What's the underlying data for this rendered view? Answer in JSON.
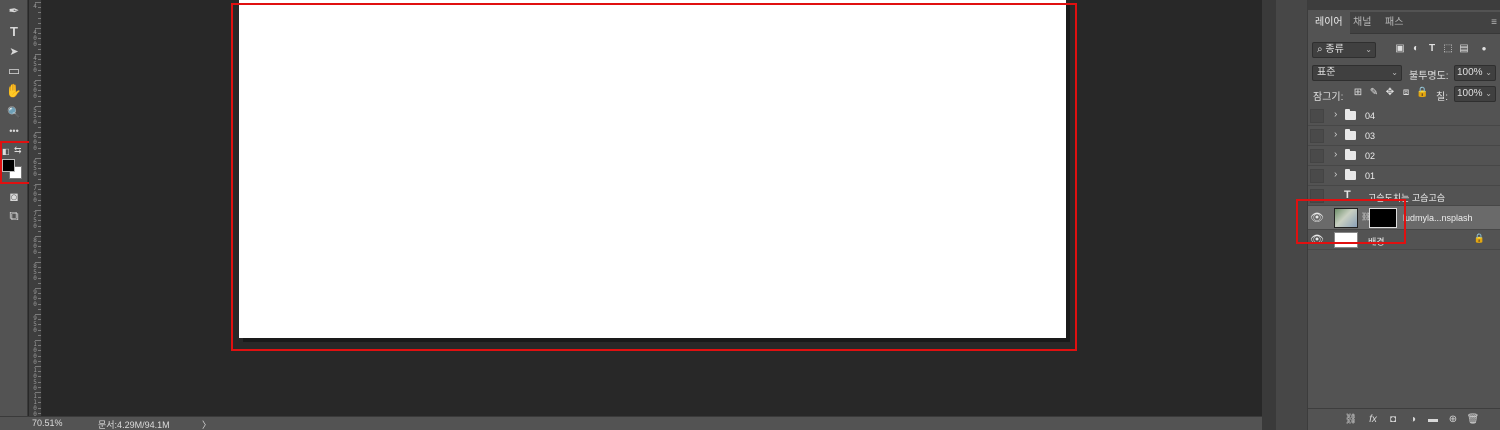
{
  "toolbar": {
    "tools": [
      {
        "name": "pen-tool-icon",
        "glyph": "✒"
      },
      {
        "name": "type-tool-icon",
        "glyph": "T"
      },
      {
        "name": "path-selection-tool-icon",
        "glyph": "➤"
      },
      {
        "name": "rectangle-tool-icon",
        "glyph": "▭"
      },
      {
        "name": "hand-tool-icon",
        "glyph": "✋"
      },
      {
        "name": "zoom-tool-icon",
        "glyph": "🔍"
      },
      {
        "name": "more-tools-icon",
        "glyph": "•••"
      },
      {
        "name": "quick-mask-icon",
        "glyph": "◙"
      },
      {
        "name": "screen-mode-icon",
        "glyph": "⧉"
      }
    ],
    "foreground_color": "#000000",
    "background_color": "#ffffff"
  },
  "ruler": {
    "labels": [
      "4",
      "4 0 0",
      "4 5 0",
      "5 0 0",
      "5 5 0",
      "6 0 0",
      "6 5 0",
      "7 0 0",
      "7 5 0",
      "8 0 0",
      "8 5 0",
      "9 0 0",
      "9 5 0",
      "1 0 0 0",
      "1 0 5 0",
      "1 1 0 0"
    ]
  },
  "status": {
    "zoom": "70.51%",
    "doc_info": "문서:4.29M/94.1M",
    "arrow": "〉"
  },
  "layers_panel": {
    "tabs": [
      {
        "label": "레이어",
        "active": true
      },
      {
        "label": "채널",
        "active": false
      },
      {
        "label": "패스",
        "active": false
      }
    ],
    "menu": "≡",
    "filter_kind": "종류",
    "blend_mode": "표준",
    "opacity_label": "불투명도:",
    "opacity_value": "100%",
    "lock_label": "잠그기:",
    "fill_label": "칠:",
    "fill_value": "100%",
    "layers": [
      {
        "kind": "group",
        "name": "04",
        "visible": false
      },
      {
        "kind": "group",
        "name": "03",
        "visible": false
      },
      {
        "kind": "group",
        "name": "02",
        "visible": false
      },
      {
        "kind": "group",
        "name": "01",
        "visible": false
      },
      {
        "kind": "text",
        "name": "고슴도치는 고슴고슴",
        "visible": false
      },
      {
        "kind": "masked-image",
        "name": "ludmyla...nsplash",
        "visible": true,
        "selected": true
      },
      {
        "kind": "background",
        "name": "배경",
        "visible": true,
        "locked": true
      }
    ]
  },
  "highlight_color": "#e01010"
}
